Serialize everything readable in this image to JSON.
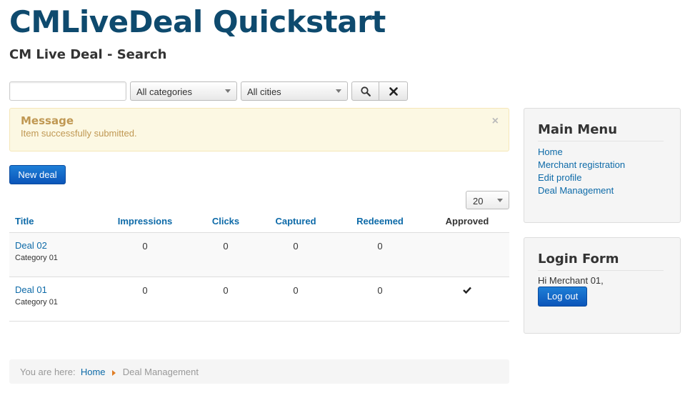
{
  "site": {
    "title": "CMLiveDeal Quickstart",
    "subtitle": "CM Live Deal - Search"
  },
  "filters": {
    "search_placeholder": "",
    "category": "All categories",
    "city": "All cities",
    "search_icon": "search-icon",
    "clear_icon": "close-icon"
  },
  "alert": {
    "heading": "Message",
    "text": "Item successfully submitted.",
    "close": "×"
  },
  "toolbar": {
    "new_deal_label": "New deal",
    "limit": "20"
  },
  "table": {
    "headers": {
      "title": "Title",
      "impressions": "Impressions",
      "clicks": "Clicks",
      "captured": "Captured",
      "redeemed": "Redeemed",
      "approved": "Approved"
    },
    "rows": [
      {
        "title": "Deal 02",
        "category": "Category 01",
        "impressions": "0",
        "clicks": "0",
        "captured": "0",
        "redeemed": "0",
        "approved": false
      },
      {
        "title": "Deal 01",
        "category": "Category 01",
        "impressions": "0",
        "clicks": "0",
        "captured": "0",
        "redeemed": "0",
        "approved": true
      }
    ]
  },
  "breadcrumb": {
    "prefix": "You are here:",
    "home": "Home",
    "current": "Deal Management"
  },
  "main_menu": {
    "title": "Main Menu",
    "items": [
      {
        "label": "Home"
      },
      {
        "label": "Merchant registration"
      },
      {
        "label": "Edit profile"
      },
      {
        "label": "Deal Management"
      }
    ]
  },
  "login_form": {
    "title": "Login Form",
    "greeting": "Hi Merchant 01,",
    "logout_label": "Log out"
  },
  "colors": {
    "title": "#0e4a6e",
    "link": "#0d6aa8",
    "primary_button": "#0b55b9",
    "alert_bg": "#fcf8e3",
    "alert_text": "#c09853"
  }
}
